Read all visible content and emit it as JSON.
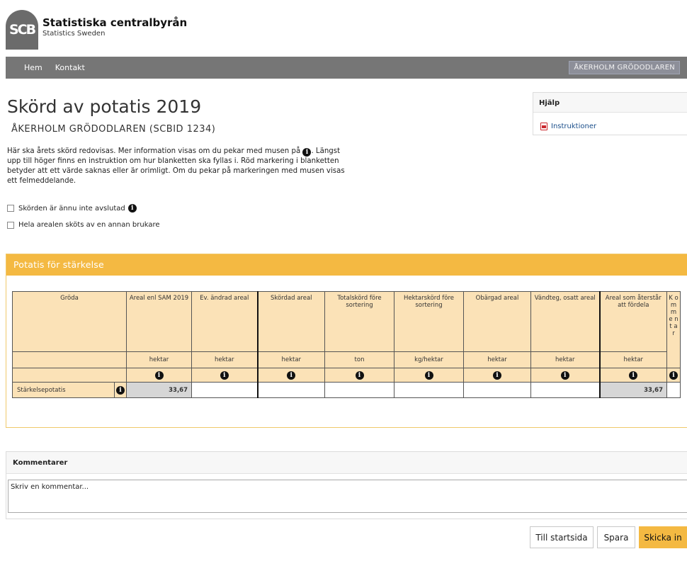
{
  "brand": {
    "logo_text": "SCB",
    "name": "Statistiska centralbyrån",
    "subtitle": "Statistics Sweden"
  },
  "nav": {
    "items": [
      "Hem",
      "Kontakt"
    ],
    "user": "ÅKERHOLM GRÖDODLAREN"
  },
  "page": {
    "title": "Skörd av potatis 2019",
    "subtitle": "ÅKERHOLM GRÖDODLAREN (SCBID 1234)",
    "intro_before_icon": "Här ska årets skörd redovisas. Mer information visas om du pekar med musen på ",
    "intro_after_icon": ". Längst upp till höger finns en instruktion om hur blanketten ska fyllas i. Röd markering i blanketten betyder att ett värde saknas eller är orimligt. Om du pekar på markeringen med musen visas ett felmeddelande.",
    "checkbox_1": "Skörden är ännu inte avslutad",
    "checkbox_2": "Hela arealen sköts av en annan brukare"
  },
  "help": {
    "title": "Hjälp",
    "link": "Instruktioner"
  },
  "panel": {
    "title": "Potatis för stärkelse",
    "columns": [
      {
        "label": "Gröda",
        "unit": ""
      },
      {
        "label": "Areal enl SAM 2019",
        "unit": "hektar"
      },
      {
        "label": "Ev. ändrad areal",
        "unit": "hektar"
      },
      {
        "label": "Skördad areal",
        "unit": "hektar"
      },
      {
        "label": "Totalskörd före sortering",
        "unit": "ton"
      },
      {
        "label": "Hektarskörd före sortering",
        "unit": "kg/hektar"
      },
      {
        "label": "Obärgad areal",
        "unit": "hektar"
      },
      {
        "label": "Vändteg, osatt areal",
        "unit": "hektar"
      },
      {
        "label": "Areal som återstår att fördela",
        "unit": "hektar"
      },
      {
        "label": "K o m m e n t a r",
        "unit": ""
      }
    ],
    "row": {
      "label": "Stärkelsepotatis",
      "sam_areal": "33,67",
      "remaining": "33,67"
    },
    "info_glyph": "i"
  },
  "comments": {
    "title": "Kommentarer",
    "placeholder": "Skriv en kommentar..."
  },
  "buttons": {
    "start": "Till startsida",
    "save": "Spara",
    "send": "Skicka in"
  },
  "colors": {
    "accent": "#f4b942",
    "nav_bg": "#767676",
    "table_header_bg": "#fbe2b7"
  }
}
